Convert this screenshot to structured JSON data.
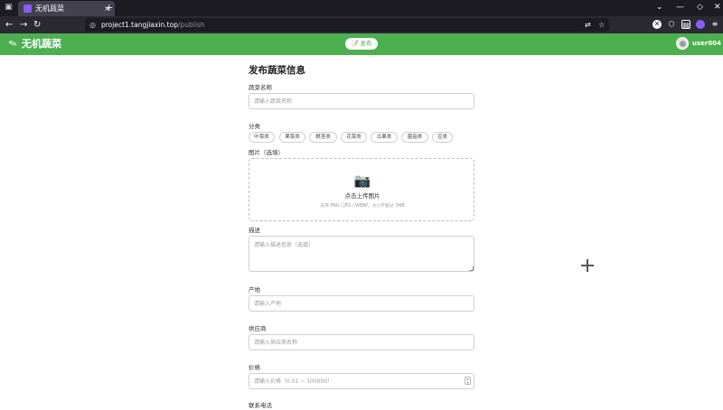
{
  "browser": {
    "tab_title": "无机蔬菜",
    "tab_close": "×",
    "new_tab": "+",
    "url_host": "project1.tangjiaxin.top",
    "url_path": "/publish"
  },
  "header": {
    "brand": "无机蔬菜",
    "publish_label": "📝 发布",
    "username": "user004",
    "accent": "#4caf50"
  },
  "form": {
    "title": "发布蔬菜信息",
    "name_label": "蔬菜名称",
    "name_placeholder": "请输入蔬菜名称",
    "category_label": "分类",
    "categories": [
      "叶菜类",
      "果菜类",
      "根茎类",
      "花菜类",
      "瓜果类",
      "菌菇类",
      "豆类"
    ],
    "image_label": "图片（选填）",
    "upload_icon": "📷",
    "upload_text": "点击上传图片",
    "upload_hint": "支持 PNG / JPG / WEBP，大小不超过 3MB",
    "desc_label": "描述",
    "desc_placeholder": "请输入描述信息（选填）",
    "origin_label": "产地",
    "origin_placeholder": "请输入产地",
    "supplier_label": "供应商",
    "supplier_placeholder": "请输入供应商名称",
    "price_label": "价格",
    "price_placeholder": "请输入价格（0.01 ~ 100000）",
    "contact_label": "联系电话"
  }
}
